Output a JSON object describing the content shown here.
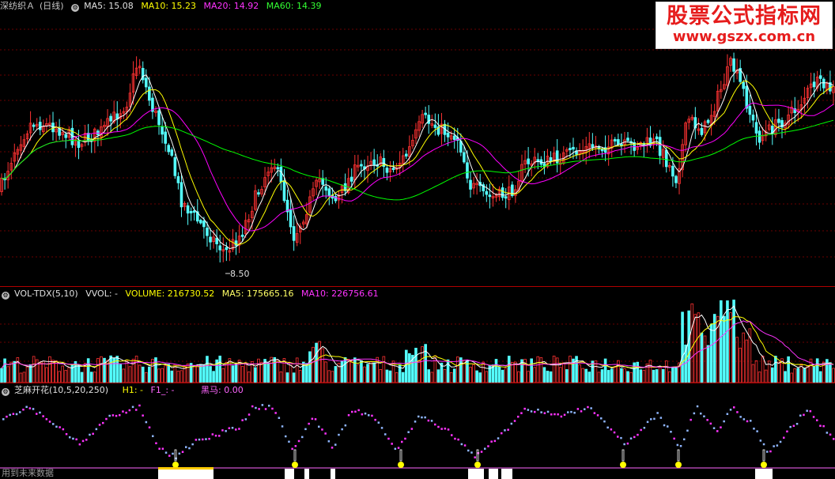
{
  "main_panel": {
    "stock_name": "深纺织Ａ",
    "period": "(日线)",
    "ma5_label": "MA5: 15.08",
    "ma10_label": "MA10: 15.23",
    "ma20_label": "MA20: 14.92",
    "ma60_label": "MA60: 14.39",
    "low_marker": "8.50"
  },
  "volume_panel": {
    "indicator": "VOL-TDX(5,10)",
    "vvol_label": "VVOL: -",
    "volume_label": "VOLUME: 216730.52",
    "ma5_label": "MA5: 175665.16",
    "ma10_label": "MA10: 226756.61"
  },
  "formula_panel": {
    "indicator": "芝麻开花(10,5,20,250)",
    "h1_label": "H1: -",
    "f1_label": "F1_: -",
    "heima_label": "黑马: 0.00"
  },
  "footer_text": "用到未来数据",
  "watermark": {
    "title": "股票公式指标网",
    "url": "www.gszx.com.cn"
  },
  "colors": {
    "up": "#ff3232",
    "down": "#54ffff",
    "ma5": "#ffffff",
    "ma10": "#ffff00",
    "ma20": "#ff00ff",
    "ma60": "#00ff00",
    "separator": "#b00000"
  }
}
